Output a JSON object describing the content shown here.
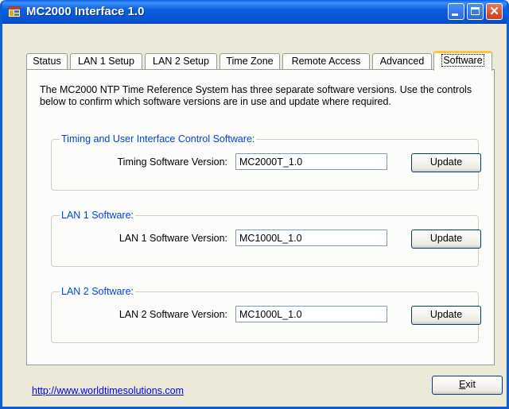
{
  "window": {
    "title": "MC2000 Interface 1.0",
    "close_glyph": "✕"
  },
  "tabs": [
    {
      "label": "Status",
      "active": false
    },
    {
      "label": "LAN 1 Setup",
      "active": false
    },
    {
      "label": "LAN 2 Setup",
      "active": false
    },
    {
      "label": "Time Zone",
      "active": false
    },
    {
      "label": "Remote Access",
      "active": false
    },
    {
      "label": "Advanced",
      "active": false
    },
    {
      "label": "Software",
      "active": true
    }
  ],
  "software": {
    "intro": "The MC2000 NTP Time Reference System has three separate software versions.  Use the controls below to confirm which software versions are in use and update where required.",
    "groups": [
      {
        "title": "Timing and User Interface Control Software:",
        "label": "Timing Software Version:",
        "value": "MC2000T_1.0",
        "button": "Update"
      },
      {
        "title": "LAN 1 Software:",
        "label": "LAN 1 Software Version:",
        "value": "MC1000L_1.0",
        "button": "Update"
      },
      {
        "title": "LAN 2 Software:",
        "label": "LAN 2 Software Version:",
        "value": "MC1000L_1.0",
        "button": "Update"
      }
    ]
  },
  "footer": {
    "link": "http://www.worldtimesolutions.com",
    "exit_accel": "E",
    "exit_rest": "xit"
  },
  "colors": {
    "titlebar": "#0a5fe0",
    "group_title": "#0046d5",
    "active_tab_accent": "#ffc83c",
    "link": "#0000ee"
  }
}
